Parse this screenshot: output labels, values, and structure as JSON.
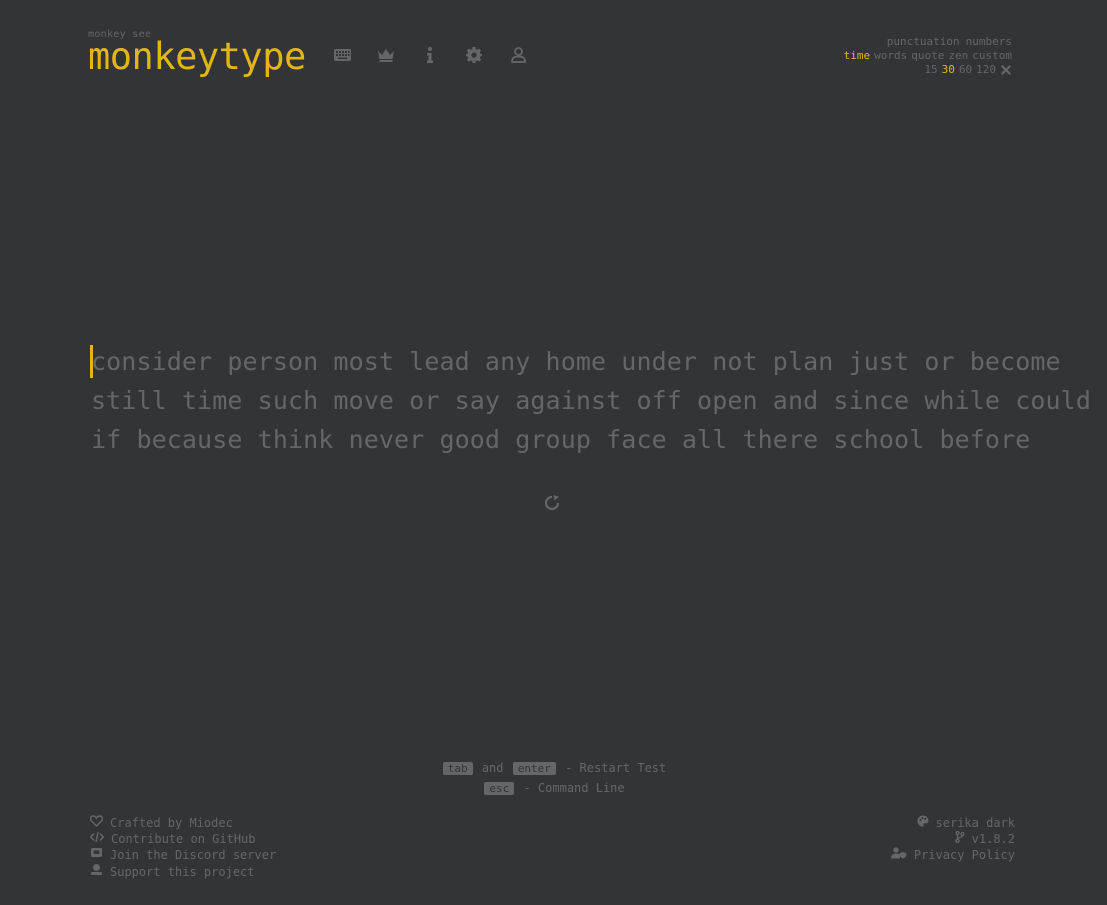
{
  "logo": {
    "top": "monkey see",
    "main": "monkeytype"
  },
  "nav": [
    {
      "name": "keyboard-icon"
    },
    {
      "name": "crown-icon"
    },
    {
      "name": "info-icon"
    },
    {
      "name": "gear-icon"
    },
    {
      "name": "user-icon"
    }
  ],
  "config": {
    "punctuation": "punctuation",
    "numbers": "numbers",
    "modes": [
      "time",
      "words",
      "quote",
      "zen",
      "custom"
    ],
    "active_mode": "time",
    "durations": [
      "15",
      "30",
      "60",
      "120"
    ],
    "active_duration": "30"
  },
  "words": {
    "lines": [
      "consider person most lead any home under not plan just or become",
      "still time such move or say against off open and since while could",
      "if because think never good group face all there school before"
    ]
  },
  "hints": {
    "tab_key": "tab",
    "and": "and",
    "enter_key": "enter",
    "restart": "- Restart Test",
    "esc_key": "esc",
    "command": "- Command Line"
  },
  "footer": {
    "left": [
      {
        "icon": "heart-icon",
        "label": "Crafted by Miodec"
      },
      {
        "icon": "code-icon",
        "label": "Contribute on GitHub"
      },
      {
        "icon": "discord-icon",
        "label": "Join the Discord server"
      },
      {
        "icon": "donate-icon",
        "label": "Support this project"
      }
    ],
    "right": [
      {
        "icon": "palette-icon",
        "label": "serika dark"
      },
      {
        "icon": "branch-icon",
        "label": "v1.8.2"
      },
      {
        "icon": "user-shield-icon",
        "label": "Privacy Policy"
      }
    ]
  },
  "colors": {
    "background": "#323437",
    "accent": "#e2b714",
    "sub": "#646669",
    "text": "#d1d0c5"
  }
}
